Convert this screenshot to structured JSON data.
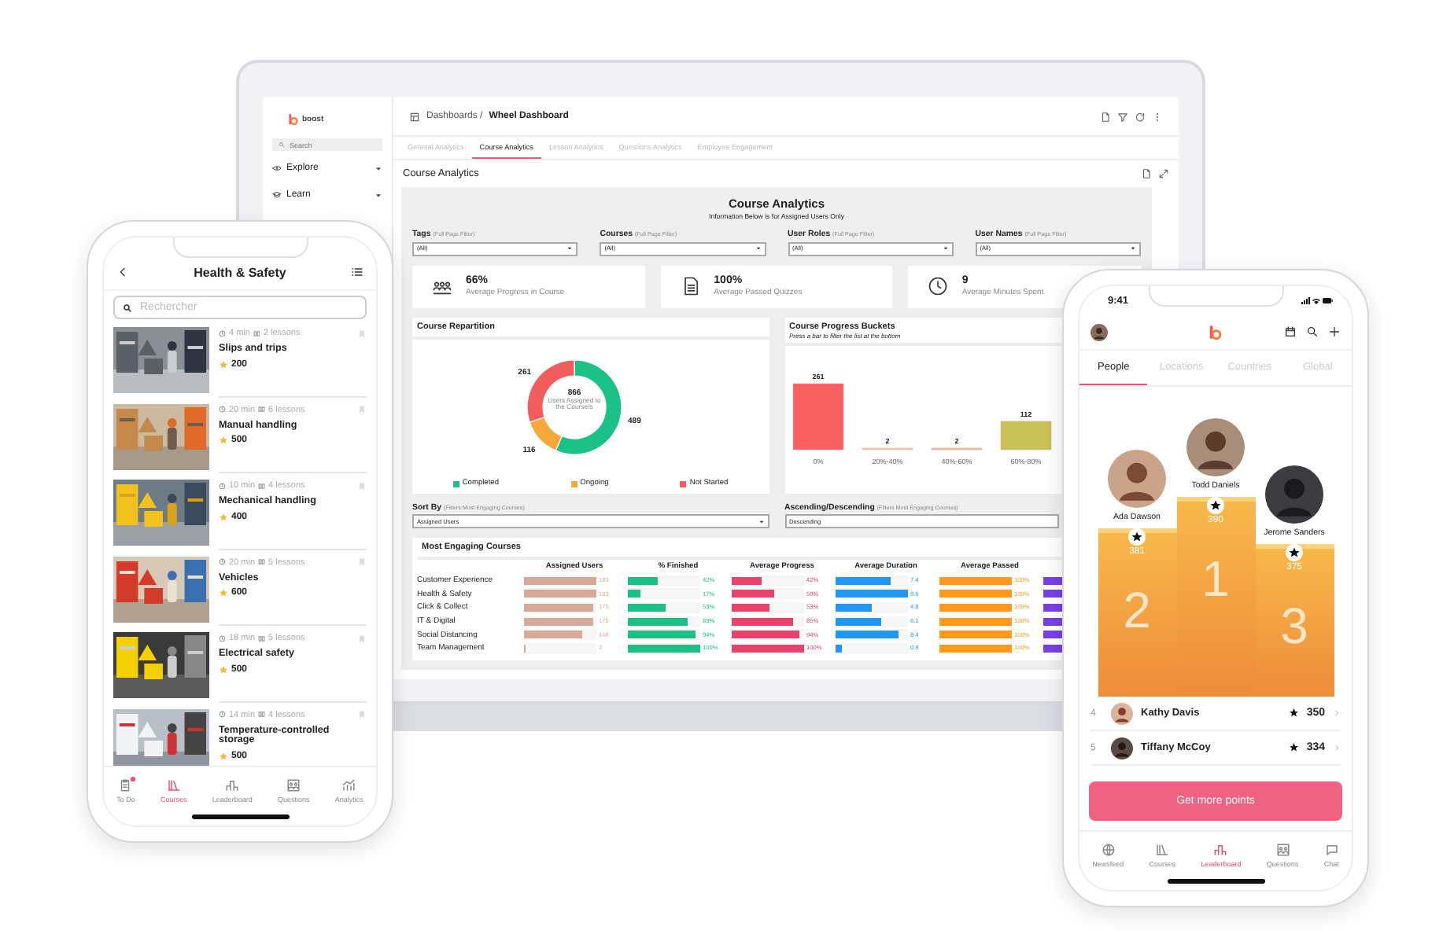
{
  "laptop": {
    "sidebar": {
      "brand": "boost",
      "search": {
        "placeholder": "Search"
      },
      "items": [
        {
          "label": "Explore"
        },
        {
          "label": "Learn"
        }
      ]
    },
    "breadcrumb": {
      "parent": "Dashboards /",
      "current": "Wheel Dashboard"
    },
    "tabs": [
      {
        "label": "General Analytics",
        "selected": false
      },
      {
        "label": "Course Analytics",
        "selected": true
      },
      {
        "label": "Lesson Analytics",
        "selected": false
      },
      {
        "label": "Questions Analytics",
        "selected": false
      },
      {
        "label": "Employee Engagement",
        "selected": false
      }
    ],
    "section_title": "Course Analytics",
    "report": {
      "title": "Course Analytics",
      "subtitle": "Information Below is for Assigned Users Only",
      "filters": [
        {
          "label": "Tags",
          "hint": "(Full Page Filter)",
          "value": "(All)"
        },
        {
          "label": "Courses",
          "hint": "(Full Page Filter)",
          "value": "(All)"
        },
        {
          "label": "User Roles",
          "hint": "(Full Page Filter)",
          "value": "(All)"
        },
        {
          "label": "User Names",
          "hint": "(Full Page Filter)",
          "value": "(All)"
        }
      ],
      "stats": [
        {
          "value": "66%",
          "label": "Average Progress in Course"
        },
        {
          "value": "100%",
          "label": "Average Passed Quizzes"
        },
        {
          "value": "9",
          "label": "Average Minutes Spent"
        }
      ],
      "repartition": {
        "title": "Course Repartition",
        "center_value": "866",
        "center_label": "Users Assigned to the Course/s",
        "chart_data": {
          "type": "donut",
          "categories": [
            "Completed",
            "Ongoing",
            "Not Started"
          ],
          "series": [
            {
              "values": [
                489,
                116,
                261
              ]
            }
          ],
          "colors": [
            "#1cc187",
            "#f6a83b",
            "#f45d5d"
          ],
          "data_labels": true
        }
      },
      "buckets": {
        "title": "Course Progress Buckets",
        "hint": "Press a bar to filter the list at the bottom",
        "chart_data": {
          "type": "bar",
          "categories": [
            "0%",
            "20%-40%",
            "40%-60%",
            "60%-80%"
          ],
          "series": [
            {
              "values": [
                261,
                2,
                2,
                112
              ]
            }
          ],
          "colors": [
            "#f85f5f",
            "#fbd5a5",
            "#f9c28a",
            "#c9c256"
          ],
          "data_labels": true
        }
      },
      "sort": [
        {
          "label": "Sort By",
          "hint": "(Filters Most Engaging Courses)",
          "value": "Assigned Users"
        },
        {
          "label": "Ascending/Descending",
          "hint": "(Filters Most Engaging Courses)",
          "value": "Descending"
        }
      ],
      "table": {
        "title": "Most Engaging Courses",
        "columns": [
          {
            "name": "Assigned Users",
            "color": "#d6a999"
          },
          {
            "name": "% Finished",
            "color": "#1cbf84"
          },
          {
            "name": "Average Progress",
            "color": "#e9436b"
          },
          {
            "name": "Average Duration",
            "color": "#2196f3"
          },
          {
            "name": "Average Passed",
            "color": "#ff9a1f"
          }
        ],
        "rows": [
          {
            "name": "Customer Experience",
            "cells": [
              {
                "text": "183",
                "level": 1
              },
              {
                "text": "42%",
                "level": 0.42
              },
              {
                "text": "42%",
                "level": 0.42
              },
              {
                "text": "7.4",
                "level": 0.77
              },
              {
                "text": "100%",
                "level": 1
              }
            ]
          },
          {
            "name": "Health & Safety",
            "cells": [
              {
                "text": "183",
                "level": 1
              },
              {
                "text": "17%",
                "level": 0.17
              },
              {
                "text": "59%",
                "level": 0.59
              },
              {
                "text": "9.6",
                "level": 1
              },
              {
                "text": "100%",
                "level": 1
              }
            ]
          },
          {
            "name": "Click & Collect",
            "cells": [
              {
                "text": "175",
                "level": 0.96
              },
              {
                "text": "53%",
                "level": 0.53
              },
              {
                "text": "53%",
                "level": 0.53
              },
              {
                "text": "4.8",
                "level": 0.5
              },
              {
                "text": "100%",
                "level": 1
              }
            ]
          },
          {
            "name": "IT & Digital",
            "cells": [
              {
                "text": "175",
                "level": 0.96
              },
              {
                "text": "83%",
                "level": 0.83
              },
              {
                "text": "85%",
                "level": 0.85
              },
              {
                "text": "6.1",
                "level": 0.64
              },
              {
                "text": "100%",
                "level": 1
              }
            ]
          },
          {
            "name": "Social Distancing",
            "cells": [
              {
                "text": "148",
                "level": 0.81
              },
              {
                "text": "94%",
                "level": 0.94
              },
              {
                "text": "94%",
                "level": 0.94
              },
              {
                "text": "8.4",
                "level": 0.88
              },
              {
                "text": "100%",
                "level": 1
              }
            ]
          },
          {
            "name": "Team Management",
            "cells": [
              {
                "text": "2",
                "level": 0.01
              },
              {
                "text": "100%",
                "level": 1
              },
              {
                "text": "100%",
                "level": 1
              },
              {
                "text": "0.9",
                "level": 0.09
              },
              {
                "text": "100%",
                "level": 1
              }
            ]
          }
        ]
      }
    }
  },
  "left_phone": {
    "title": "Health & Safety",
    "search": {
      "placeholder": "Rechercher"
    },
    "courses": [
      {
        "duration": "4 min",
        "lessons": "2 lessons",
        "title": "Slips and trips",
        "points": "200"
      },
      {
        "duration": "20 min",
        "lessons": "6 lessons",
        "title": "Manual handling",
        "points": "500"
      },
      {
        "duration": "10 min",
        "lessons": "4 lessons",
        "title": "Mechanical handling",
        "points": "400"
      },
      {
        "duration": "20 min",
        "lessons": "5 lessons",
        "title": "Vehicles",
        "points": "600"
      },
      {
        "duration": "18 min",
        "lessons": "5 lessons",
        "title": "Electrical safety",
        "points": "500"
      },
      {
        "duration": "14 min",
        "lessons": "4 lessons",
        "title": "Temperature-controlled storage",
        "points": "500"
      }
    ],
    "nav": [
      {
        "label": "To Do",
        "selected": false,
        "notification": true
      },
      {
        "label": "Courses",
        "selected": true,
        "notification": false
      },
      {
        "label": "Leaderboard",
        "selected": false,
        "notification": false
      },
      {
        "label": "Questions",
        "selected": false,
        "notification": false
      },
      {
        "label": "Analytics",
        "selected": false,
        "notification": false
      }
    ]
  },
  "right_phone": {
    "time": "9:41",
    "tabs": [
      {
        "label": "People",
        "selected": true
      },
      {
        "label": "Locations",
        "selected": false
      },
      {
        "label": "Countries",
        "selected": false
      },
      {
        "label": "Global",
        "selected": false
      }
    ],
    "podium": [
      {
        "name": "Ada Dawson",
        "points": "381",
        "place": "2"
      },
      {
        "name": "Todd Daniels",
        "points": "390",
        "place": "1"
      },
      {
        "name": "Jerome Sanders",
        "points": "375",
        "place": "3"
      }
    ],
    "ranking": [
      {
        "rank": "4",
        "name": "Kathy Davis",
        "points": "350"
      },
      {
        "rank": "5",
        "name": "Tiffany McCoy",
        "points": "334"
      }
    ],
    "button": "Get more points",
    "nav": [
      {
        "label": "Newsfeed",
        "selected": false
      },
      {
        "label": "Courses",
        "selected": false
      },
      {
        "label": "Leaderboard",
        "selected": true
      },
      {
        "label": "Questions",
        "selected": false
      },
      {
        "label": "Chat",
        "selected": false
      }
    ]
  }
}
